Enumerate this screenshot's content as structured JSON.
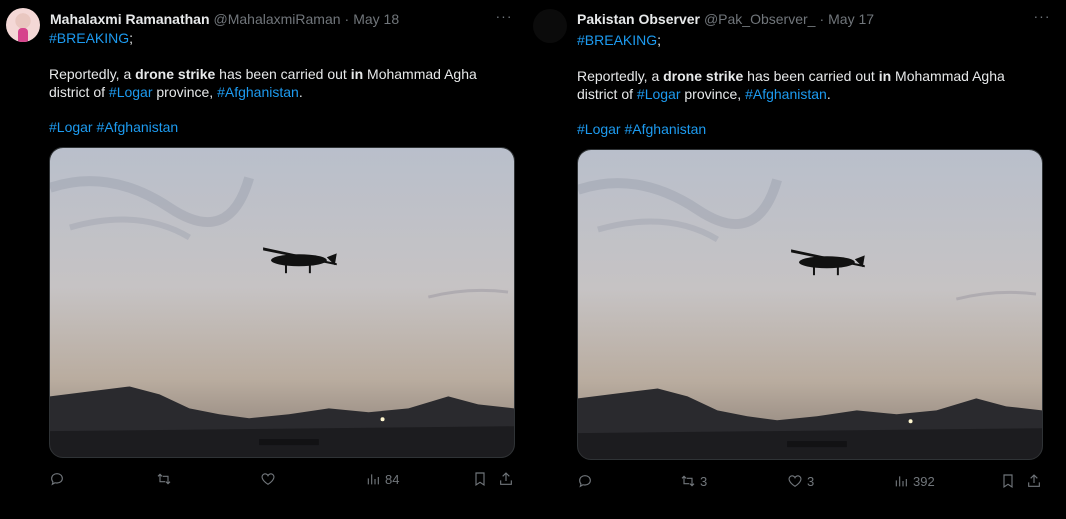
{
  "tweets": [
    {
      "display_name": "Mahalaxmi Ramanathan",
      "handle": "@MahalaxmiRaman",
      "separator": "·",
      "date": "May 18",
      "more": "···",
      "line1_hashtag": "#BREAKING",
      "line1_tail": ";",
      "p_part1": "Reportedly, a ",
      "p_bold1": "drone strike",
      "p_part2": " has been carried out ",
      "p_bold2": "in",
      "p_part3": " Mohammad Agha",
      "p_line2_start": "district of ",
      "p_tag1": "#Logar",
      "p_part4": " province, ",
      "p_tag2": "#Afghanistan",
      "p_end": ".",
      "tags_line": [
        "#Logar",
        "#Afghanistan"
      ],
      "actions": {
        "reply": "",
        "retweet": "",
        "like": "",
        "views": "84"
      }
    },
    {
      "display_name": "Pakistan Observer",
      "handle": "@Pak_Observer_",
      "separator": "·",
      "date": "May 17",
      "more": "···",
      "line1_hashtag": "#BREAKING",
      "line1_tail": ";",
      "p_part1": "Reportedly, a ",
      "p_bold1": "drone strike",
      "p_part2": " has been carried out ",
      "p_bold2": "in",
      "p_part3": " Mohammad Agha",
      "p_line2_start": "district of ",
      "p_tag1": "#Logar",
      "p_part4": " province, ",
      "p_tag2": "#Afghanistan",
      "p_end": ".",
      "tags_line": [
        "#Logar",
        "#Afghanistan"
      ],
      "actions": {
        "reply": "",
        "retweet": "3",
        "like": "3",
        "views": "392"
      }
    }
  ],
  "icons": {
    "reply": "reply-icon",
    "retweet": "retweet-icon",
    "like": "heart-icon",
    "views": "views-icon",
    "bookmark": "bookmark-icon",
    "share": "share-icon",
    "more": "more-icon"
  },
  "colors": {
    "hashtag": "#1d9bf0",
    "muted": "#71767b",
    "text": "#e7e9ea",
    "background": "#000000"
  }
}
